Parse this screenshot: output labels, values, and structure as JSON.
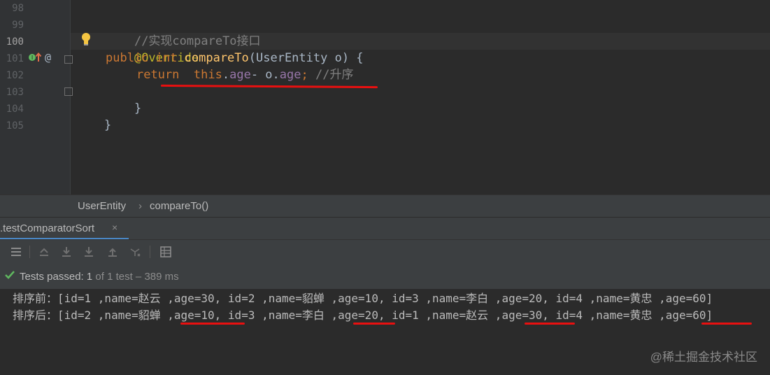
{
  "editor": {
    "line_numbers": [
      "98",
      "99",
      "100",
      "101",
      "102",
      "103",
      "104",
      "105"
    ],
    "lines": {
      "comment": "//实现compareTo接口",
      "annotation": "@Override",
      "sig_public": "public",
      "sig_int": "int",
      "sig_name": "compareTo",
      "sig_rest": "(UserEntity o) {",
      "ret_kw": "return",
      "ret_this": "this",
      "ret_dot1": ".",
      "ret_age1": "age",
      "ret_minus": "- o.",
      "ret_age2": "age",
      "ret_semi": ";",
      "ret_comment": "//升序",
      "close_inner": "}",
      "close_outer": "}"
    },
    "gutter_at": "@"
  },
  "breadcrumb": {
    "class_name": "UserEntity",
    "separator": "›",
    "method_name": "compareTo()"
  },
  "run_tab": {
    "label": ".testComparatorSort",
    "close": "×"
  },
  "status": {
    "passed_label": "Tests passed: ",
    "count": "1",
    "rest": " of 1 test – 389 ms"
  },
  "console": {
    "before": "排序前：[id=1 ,name=赵云 ,age=30, id=2 ,name=貂蝉 ,age=10, id=3 ,name=李白 ,age=20, id=4 ,name=黄忠 ,age=60]",
    "after": "排序后：[id=2 ,name=貂蝉 ,age=10, id=3 ,name=李白 ,age=20, id=1 ,name=赵云 ,age=30, id=4 ,name=黄忠 ,age=60]"
  },
  "watermark": "@稀土掘金技术社区",
  "colors": {
    "annotation_marks": "#e81010",
    "keyword": "#cc7832",
    "method": "#ffc66d",
    "field": "#9876aa",
    "tab_accent": "#4a88c7",
    "pass_green": "#5fb85f"
  }
}
